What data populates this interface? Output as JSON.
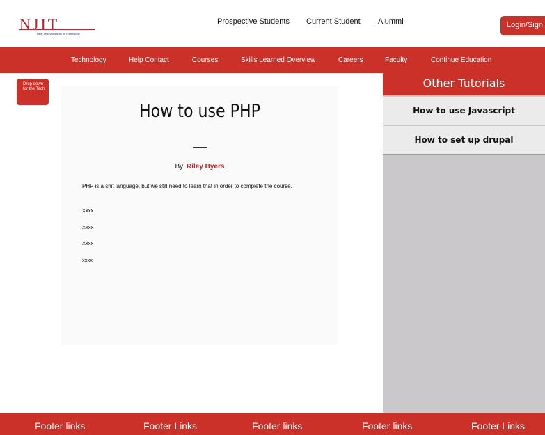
{
  "header": {
    "logo_text": "NJIT",
    "logo_subtitle": "New Jersey Institute of Technology",
    "links": [
      "Prospective Students",
      "Current Student",
      "Alummi"
    ],
    "login_label": "Login/Sign up"
  },
  "navbar": {
    "items": [
      "Technology",
      "Help Contact",
      "Courses",
      "Skills Learned Overview",
      "Careers",
      "Faculty",
      "Continue Education"
    ]
  },
  "dropdown": {
    "label": "Drop down for the Tech"
  },
  "article": {
    "title": "How to use PHP",
    "byline_prefix": "By.",
    "author": "Riley Byers",
    "paragraph": "PHP is a shit language, but we still need to learn that in order to complete the course.",
    "lines": [
      "Xxxx",
      "Xxxx",
      "Xxxx",
      "xxxx"
    ]
  },
  "sidebar": {
    "title": "Other Tutorials",
    "links": [
      "How to use Javascript",
      "How to set up drupal"
    ]
  },
  "footer": {
    "links": [
      "Footer links",
      "Footer Links",
      "Footer links",
      "Footer links",
      "Footer Links"
    ]
  },
  "colors": {
    "brand_red": "#cc3129",
    "sidebar_gray": "#cbc8cb"
  }
}
